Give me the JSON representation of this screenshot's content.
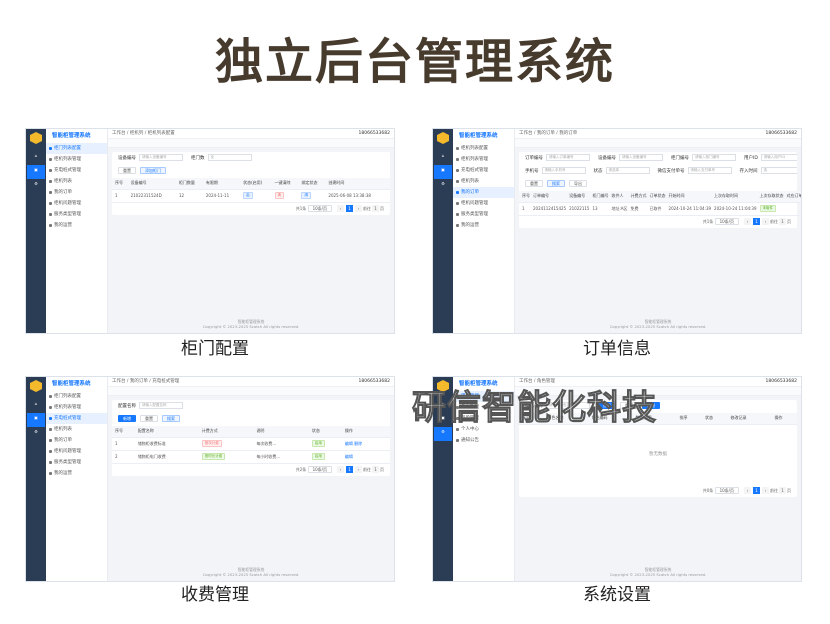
{
  "page_title": "独立后台管理系统",
  "watermark": "研信智能化科技",
  "panels": {
    "p1": {
      "caption": "柜门配置",
      "sidebar_title": "智能柜管理系统",
      "sidebar": [
        "柜门列表配置",
        "柜机列表管理",
        "充电桩式管理",
        "柜机列表",
        "我的订单",
        "柜机问题管理",
        "服务类型管理",
        "我的运营"
      ],
      "breadcrumb": "工作台 / 柜机列 / 柜机列表配置",
      "user": "18066533682",
      "tabs": [
        "工作台",
        "柜机列表配置"
      ],
      "filters": [
        {
          "label": "设备编号",
          "placeholder": "请输入设备编号"
        },
        {
          "label": "柜门数",
          "placeholder": "全"
        }
      ],
      "buttons": {
        "reset": "重置",
        "add": "添加柜门"
      },
      "headers": [
        "序号",
        "设备编号",
        "柜门数量",
        "有限期",
        "状态(启用)",
        "一键清除",
        "绑定状态",
        "创建时间"
      ],
      "rows": [
        [
          "1",
          "21022311524D",
          "12",
          "2024-11-11",
          "启",
          "清",
          "绑",
          "2025-06-08 13:38:38"
        ]
      ],
      "pager": {
        "total": "共1条",
        "size": "10条/页",
        "page": "1",
        "goto": "前往",
        "goto_page": "1",
        "unit": "页"
      },
      "footer_line1": "智能柜管理系统",
      "footer_line2": "Copyright © 2023-2025 Scatch All rights reserved."
    },
    "p2": {
      "caption": "订单信息",
      "sidebar_title": "智能柜管理系统",
      "sidebar": [
        "柜机列表配置",
        "柜机列表管理",
        "充电桩式管理",
        "柜机列表",
        "我的订单",
        "柜机问题管理",
        "服务类型管理",
        "我的运营"
      ],
      "breadcrumb": "工作台 / 我的订单 / 我的订单",
      "user": "18066533682",
      "tabs": [
        "工作台",
        "柜机列表配置",
        "我的订单"
      ],
      "filters_row1": [
        {
          "label": "订单编号",
          "placeholder": "请输入订单编号"
        },
        {
          "label": "设备编号",
          "placeholder": "请输入设备编号"
        },
        {
          "label": "柜门编号",
          "placeholder": "请输入柜门编号"
        },
        {
          "label": "用户ID",
          "placeholder": "请输入用户ID"
        }
      ],
      "filters_row2": [
        {
          "label": "手机号",
          "placeholder": "请输入手机号"
        },
        {
          "label": "状态",
          "placeholder": "请选择"
        },
        {
          "label": "微信支付单号",
          "placeholder": "请输入支付单号"
        },
        {
          "label": "存入时间",
          "placeholder": "选"
        }
      ],
      "buttons": {
        "reset": "重置",
        "search": "搜索",
        "export": "导出"
      },
      "headers": [
        "序号",
        "订单编号",
        "设备编号",
        "柜门编号",
        "收件人",
        "计费方式",
        "订单状态",
        "开始时间",
        "上次存取时间",
        "上次存取状态",
        "对应订单",
        "操作"
      ],
      "rows": [
        [
          "1",
          "2024112415425",
          "21022115",
          "13",
          "地址:A区",
          "免费",
          "已取件",
          "2024-10-24 11:04:39",
          "2024-10-24 11:04:39",
          "未取件",
          "",
          "查看订单"
        ]
      ],
      "pager": {
        "total": "共1条",
        "size": "10条/页",
        "page": "1",
        "goto": "前往",
        "goto_page": "1",
        "unit": "页"
      },
      "footer_line1": "智能柜管理系统",
      "footer_line2": "Copyright © 2023-2025 Scatch All rights reserved."
    },
    "p3": {
      "caption": "收费管理",
      "sidebar_title": "智能柜管理系统",
      "sidebar": [
        "柜门列表配置",
        "柜机列表管理",
        "充电桩式管理",
        "柜机列表",
        "我的订单",
        "柜机问题管理",
        "服务类型管理",
        "我的运营"
      ],
      "breadcrumb": "工作台 / 我的订单 / 充电桩式管理",
      "user": "18066533682",
      "tabs": [
        "工作台",
        "柜机列表配置",
        "我的订单",
        "柜机问题管理",
        "服务类型管理",
        "客户管理",
        "我的客户",
        "充电桩式管理"
      ],
      "filters": [
        {
          "label": "配置名称",
          "placeholder": "请输入配置名称"
        }
      ],
      "buttons": {
        "add": "新增",
        "reset": "重置",
        "search": "搜索"
      },
      "headers": [
        "序号",
        "配置名称",
        "计费方式",
        "说明",
        "状态",
        "操作"
      ],
      "rows": [
        [
          "1",
          "储物柜收费标准",
          "按次计费",
          "每次收费...",
          "启用",
          "编辑 删除"
        ],
        [
          "2",
          "储物柜电门收费",
          "按时长计费",
          "每小时收费...",
          "启用",
          "编辑"
        ]
      ],
      "pager": {
        "total": "共2条",
        "size": "10条/页",
        "page": "1",
        "goto": "前往",
        "goto_page": "1",
        "unit": "页"
      },
      "footer_line1": "智能柜管理系统",
      "footer_line2": "Copyright © 2023-2025 Scatch All rights reserved."
    },
    "p4": {
      "caption": "系统设置",
      "sidebar_title": "智能柜管理系统",
      "sidebar": [
        "用户管理",
        "角色管理",
        "菜单管理",
        "个人中心",
        "通知公告"
      ],
      "breadcrumb": "工作台 / 角色管理",
      "user": "18066533682",
      "tabs": [
        "工作台",
        "柜机列表配置",
        "我的订单",
        "充电桩式管理",
        "服务类型管理",
        "客户管理",
        "角色管理"
      ],
      "filters": [
        {
          "label": "角色名称",
          "placeholder": "请输入角色名称"
        }
      ],
      "buttons": {
        "search": "搜索",
        "reset": "重置",
        "add": "新增"
      },
      "headers": [
        "序号",
        "角色名称",
        "角色编码",
        "数据范围",
        "排序",
        "状态",
        "修改记录",
        "操作"
      ],
      "empty": "暂无数据",
      "pager": {
        "total": "共0条",
        "size": "10条/页",
        "page": "1",
        "goto": "前往",
        "goto_page": "1",
        "unit": "页"
      },
      "footer_line1": "智能柜管理系统",
      "footer_line2": "Copyright © 2023-2025 Scatch All rights reserved."
    }
  }
}
